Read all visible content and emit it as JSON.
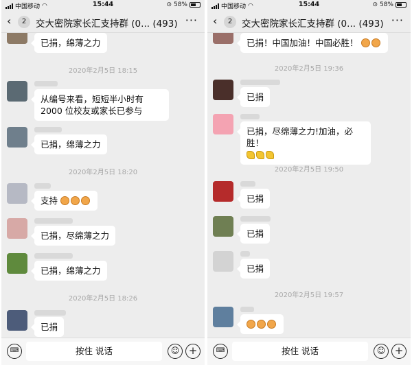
{
  "status_bar": {
    "carrier": "中国移动",
    "time": "15:44",
    "battery": "58%"
  },
  "panels": [
    {
      "nav": {
        "back_icon": "‹",
        "unread": "2",
        "title": "交大密院家长汇支持群 (0...",
        "member_count": "(493)",
        "more_icon": "···"
      },
      "input_bar": {
        "voice_icon": "keyboard-icon",
        "hold_to_talk": "按住 说话",
        "emoji_icon": "☺",
        "plus_icon": "+"
      },
      "timestamps": [
        "2020年2月5日 18:15",
        "2020年2月5日 18:20",
        "2020年2月5日 18:26"
      ],
      "messages": [
        {
          "text": "已捐，绵薄之力",
          "avatar": "#8d7a66"
        },
        {
          "text": "从编号来看，短短半小时有 2000 位校友或家长已参与",
          "avatar": "#5b6a73"
        },
        {
          "text": "已捐，绵薄之力",
          "avatar": "#6f7f8c"
        },
        {
          "text": "支持",
          "emoji": [
            "emoji-applause",
            "emoji-applause",
            "emoji-applause"
          ],
          "avatar": "#b6b9c4"
        },
        {
          "text": "已捐，尽绵薄之力",
          "avatar": "#d7a9a6"
        },
        {
          "text": "已捐，绵薄之力",
          "avatar": "#5f8a3d"
        },
        {
          "text": "已捐",
          "avatar": "#4d5c7a"
        }
      ]
    },
    {
      "nav": {
        "back_icon": "‹",
        "unread": "2",
        "title": "交大密院家长汇支持群 (0...",
        "member_count": "(493)",
        "more_icon": "···"
      },
      "input_bar": {
        "voice_icon": "keyboard-icon",
        "hold_to_talk": "按住 说话",
        "emoji_icon": "☺",
        "plus_icon": "+"
      },
      "timestamps": [
        "2020年2月5日 19:36",
        "2020年2月5日 19:50",
        "2020年2月5日 19:57"
      ],
      "messages": [
        {
          "text": "已捐！中国加油！中国必胜！",
          "emoji": [
            "emoji-applause",
            "emoji-applause"
          ],
          "avatar": "#9a6f69"
        },
        {
          "text": "已捐",
          "avatar": "#4a2f2a"
        },
        {
          "text": "已捐，尽绵薄之力!加油，必胜！",
          "emoji2": [
            "emoji-strong",
            "emoji-strong",
            "emoji-strong"
          ],
          "avatar": "#f4a3b2"
        },
        {
          "text": "已捐",
          "avatar": "#b52b2b"
        },
        {
          "text": "已捐",
          "avatar": "#6f7f53"
        },
        {
          "text": "已捐",
          "avatar": "#d3d3d3"
        },
        {
          "text": "",
          "emoji": [
            "emoji-applause",
            "emoji-applause",
            "emoji-applause"
          ],
          "avatar": "#5f7f9e"
        }
      ]
    }
  ],
  "colors": {
    "background": "#ededed",
    "bubble": "#ffffff",
    "timestamp": "#a8a8a8",
    "badge": "#d6d6d6"
  }
}
